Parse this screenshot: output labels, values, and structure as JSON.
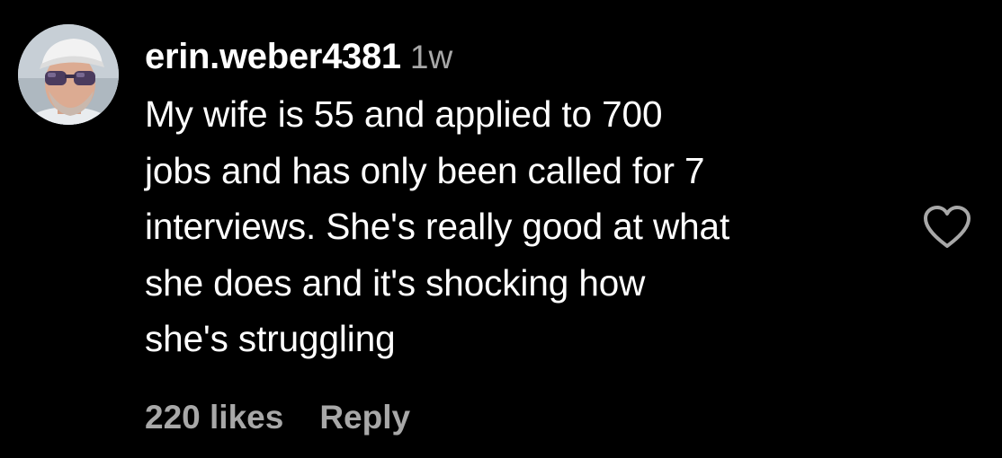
{
  "comment": {
    "username": "erin.weber4381",
    "timestamp": "1w",
    "text_lines": [
      "My wife is 55 and applied to 700",
      "jobs and has only been called for 7",
      "interviews. She's really good at what",
      "she does and it's shocking how",
      "she's struggling"
    ],
    "likes_label": "220 likes",
    "reply_label": "Reply",
    "like_icon": "heart-outline-icon"
  },
  "colors": {
    "background": "#000000",
    "primary_text": "#ffffff",
    "secondary_text": "#a8a8a8"
  }
}
